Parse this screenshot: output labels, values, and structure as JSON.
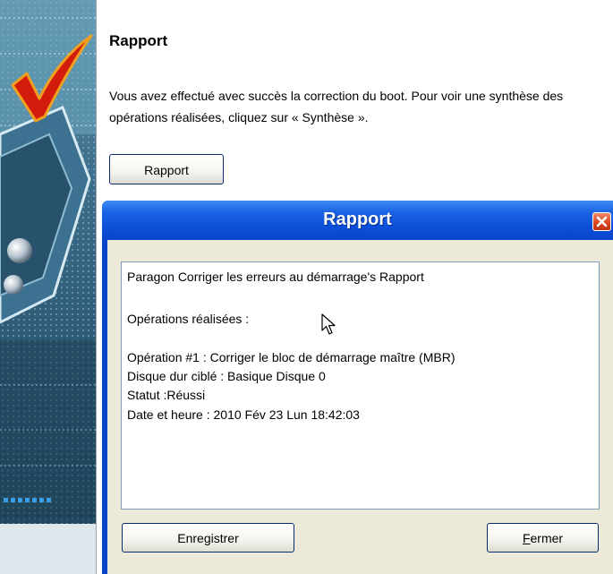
{
  "wizard": {
    "title": "Rapport",
    "description": "Vous avez effectué avec succès la correction du boot. Pour voir une synthèse des opérations réalisées, cliquez sur « Synthèse ».",
    "report_button": "Rapport"
  },
  "dialog": {
    "title": "Rapport",
    "report_lines": [
      "Paragon Corriger les erreurs au démarrage's Rapport",
      "Opérations réalisées :",
      "Opération #1 : Corriger le bloc de démarrage maître (MBR)",
      "Disque dur ciblé : Basique Disque 0",
      "Statut :Réussi",
      "Date et heure : 2010 Fév 23 Lun 18:42:03"
    ],
    "save_button": {
      "before": "Enre",
      "mnemonic": "g",
      "after": "istrer"
    },
    "close_button": {
      "before": "",
      "mnemonic": "F",
      "after": "ermer"
    }
  },
  "icons": {
    "banner_graphic": "checkmark-icon",
    "close": "close-icon",
    "cursor": "mouse-pointer-icon"
  },
  "colors": {
    "titlebar_blue": "#0a45c9",
    "dialog_face": "#ece9d8",
    "close_red": "#d9451d",
    "checkmark_red": "#d41c0c",
    "checkmark_orange": "#f0a020"
  }
}
